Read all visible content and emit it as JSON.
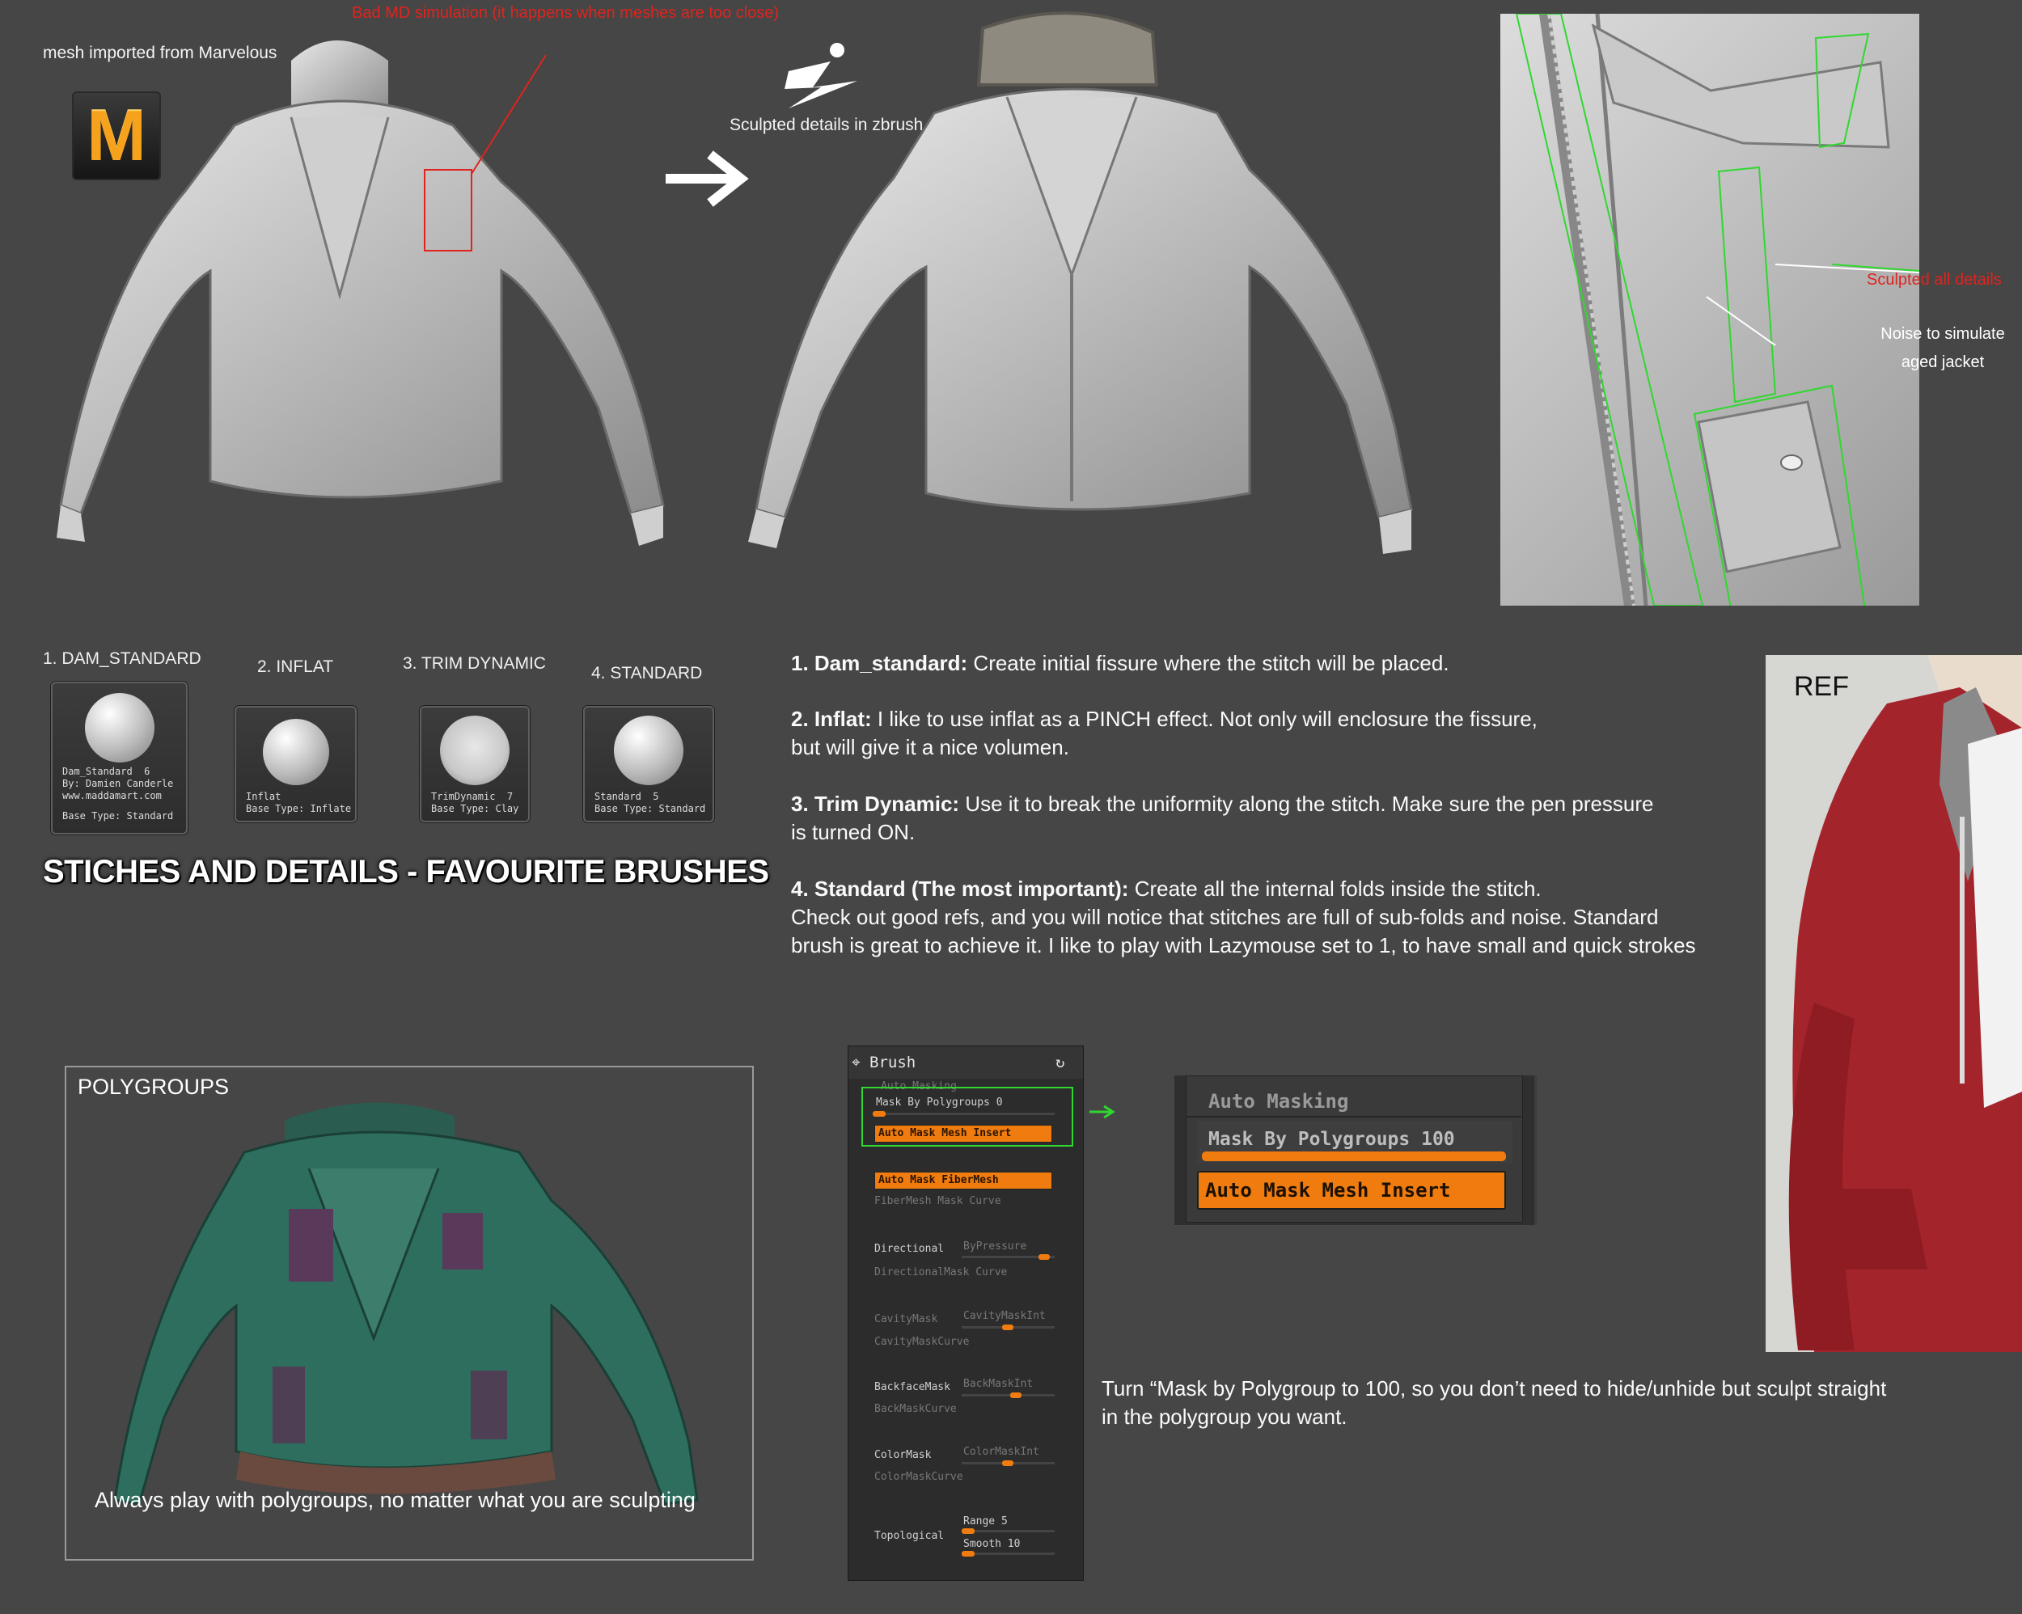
{
  "top": {
    "md_label": "mesh imported from Marvelous",
    "bad_sim": "Bad MD simulation (it happens when meshes are too close)",
    "logo_letter": "M",
    "zbrush_label": "Sculpted details in zbrush",
    "closeup_red": "Sculpted all details",
    "closeup_noise_1": "Noise to simulate",
    "closeup_noise_2": "aged jacket"
  },
  "brushes": {
    "heading": "STICHES AND DETAILS -  FAVOURITE BRUSHES",
    "items": [
      {
        "title": "1. DAM_STANDARD",
        "line1": "Dam_Standard  6",
        "line2": "By: Damien Canderle",
        "line3": "www.maddamart.com",
        "line4": "Base Type: Standard"
      },
      {
        "title": "2. INFLAT",
        "line1": "Inflat",
        "line2": "Base Type: Inflate"
      },
      {
        "title": "3. TRIM DYNAMIC",
        "line1": "TrimDynamic  7",
        "line2": "Base Type: Clay"
      },
      {
        "title": "4. STANDARD",
        "line1": "Standard  5",
        "line2": "Base Type: Standard"
      }
    ]
  },
  "tips": [
    {
      "head": "1. Dam_standard:",
      "body": " Create initial fissure where the stitch will be placed."
    },
    {
      "head": "2. Inflat:",
      "body": " I like to use inflat as a PINCH effect. Not only will enclosure the fissure,",
      "body2": "but will give it a nice volumen."
    },
    {
      "head": "3. Trim Dynamic:",
      "body": " Use it to break the uniformity along the stitch. Make sure the pen pressure",
      "body2": "is turned ON."
    },
    {
      "head": "4. Standard (The most important):",
      "body": " Create all the internal folds inside the stitch.",
      "body2": "Check out good refs, and you will notice that stitches are full of sub-folds and noise. Standard",
      "body3": "brush is great to achieve it. I like to play with Lazymouse set to 1, to have small and quick strokes"
    }
  ],
  "ref": {
    "label": "REF"
  },
  "polygroups": {
    "title": "POLYGROUPS",
    "caption": "Always play with polygroups, no matter what you are sculpting"
  },
  "zbrush_panel": {
    "title": "Brush",
    "auto_masking": "Auto Masking",
    "mask_by_polygroups": "Mask By Polygroups 0",
    "auto_mask_mesh_insert": "Auto Mask Mesh Insert",
    "auto_mask_fibermesh": "Auto Mask FiberMesh",
    "fibermesh_mask_curve": "FiberMesh Mask Curve",
    "directional": "Directional",
    "by_pressure": "ByPressure",
    "directional_mask_curve": "DirectionalMask Curve",
    "cavity_mask": "CavityMask",
    "cavity_mask_int": "CavityMaskInt",
    "cavity_mask_curve": "CavityMaskCurve",
    "backface_mask": "BackfaceMask",
    "back_mask_int": "BackMaskInt",
    "back_mask_curve": "BackMaskCurve",
    "color_mask": "ColorMask",
    "color_mask_int": "ColorMaskInt",
    "color_mask_curve": "ColorMaskCurve",
    "topological": "Topological",
    "range": "Range 5",
    "smooth": "Smooth 10"
  },
  "automask_zoom": {
    "title": "Auto Masking",
    "mask_by_polygroups": "Mask By Polygroups 100",
    "auto_mask_mesh_insert": "Auto Mask Mesh Insert",
    "mask_fraction": 1.0
  },
  "turn_note": {
    "line1": "Turn “Mask by Polygroup to 100, so you don’t need to hide/unhide but sculpt straight",
    "line2": "in the polygroup you want."
  },
  "colors": {
    "background": "#464646",
    "accent_orange": "#f07c10",
    "annotation_red": "#e0231e",
    "highlight_green": "#2fd82f",
    "jacket_red": "#a4242c",
    "jacket_green": "#2e6e5e"
  }
}
